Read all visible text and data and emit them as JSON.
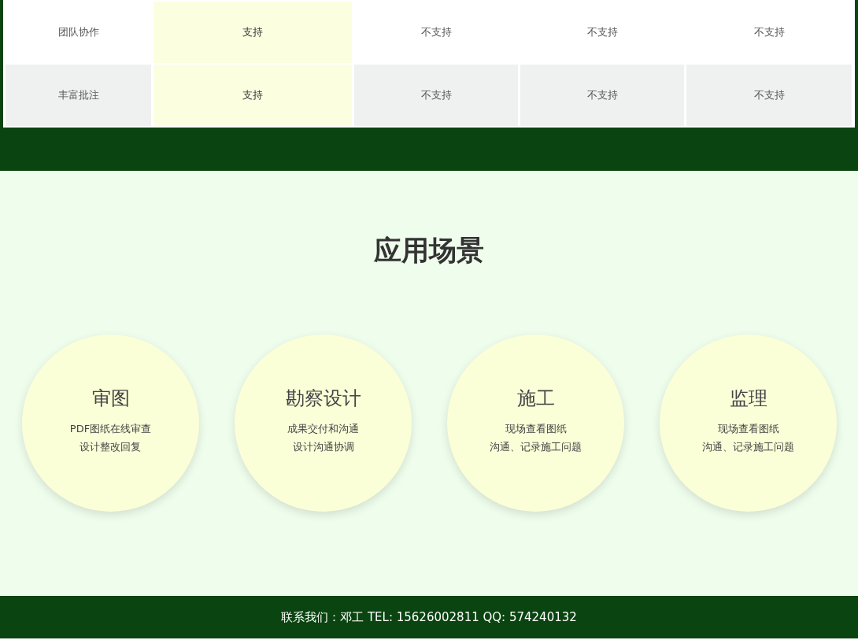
{
  "comparison_table": {
    "rows": [
      {
        "cells": [
          {
            "text": "团队协作",
            "highlighted": false
          },
          {
            "text": "支持",
            "highlighted": true
          },
          {
            "text": "不支持",
            "highlighted": false
          },
          {
            "text": "不支持",
            "highlighted": false
          },
          {
            "text": "不支持",
            "highlighted": false
          }
        ]
      },
      {
        "cells": [
          {
            "text": "丰富批注",
            "highlighted": false
          },
          {
            "text": "支持",
            "highlighted": true
          },
          {
            "text": "不支持",
            "highlighted": false
          },
          {
            "text": "不支持",
            "highlighted": false
          },
          {
            "text": "不支持",
            "highlighted": false
          }
        ]
      }
    ]
  },
  "scenarios": {
    "title": "应用场景",
    "items": [
      {
        "title": "审图",
        "lines": [
          "PDF图纸在线审查",
          "设计整改回复"
        ]
      },
      {
        "title": "勘察设计",
        "lines": [
          "成果交付和沟通",
          "设计沟通协调"
        ]
      },
      {
        "title": "施工",
        "lines": [
          "现场查看图纸",
          "沟通、记录施工问题"
        ]
      },
      {
        "title": "监理",
        "lines": [
          "现场查看图纸",
          "沟通、记录施工问题"
        ]
      }
    ]
  },
  "footer": {
    "text": "联系我们：邓工 TEL: 15626002811 QQ: 574240132"
  }
}
